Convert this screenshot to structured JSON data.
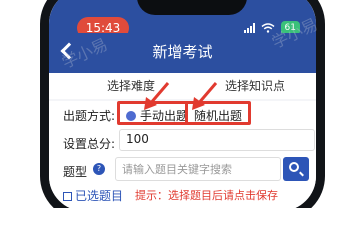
{
  "status": {
    "time": "15:43",
    "battery": "61"
  },
  "header": {
    "title": "新增考试"
  },
  "tabs": [
    {
      "label": "选择难度"
    },
    {
      "label": "选择知识点"
    }
  ],
  "form": {
    "mode_label": "出题方式:",
    "mode_options": [
      {
        "label": "手动出题",
        "selected": true
      },
      {
        "label": "随机出题",
        "selected": false
      }
    ],
    "total_label": "设置总分:",
    "total_value": "100",
    "type_label": "题型",
    "search_placeholder": "请输入题目关键字搜索",
    "selected_label": "已选题目",
    "hint": "提示：选择题目后请点击保存"
  },
  "colors": {
    "primary": "#2C4FA0",
    "highlight_border": "#E13A2F",
    "time_pill": "#E04B3B",
    "battery": "#3AC07A"
  },
  "watermark": {
    "text": "学小易"
  }
}
